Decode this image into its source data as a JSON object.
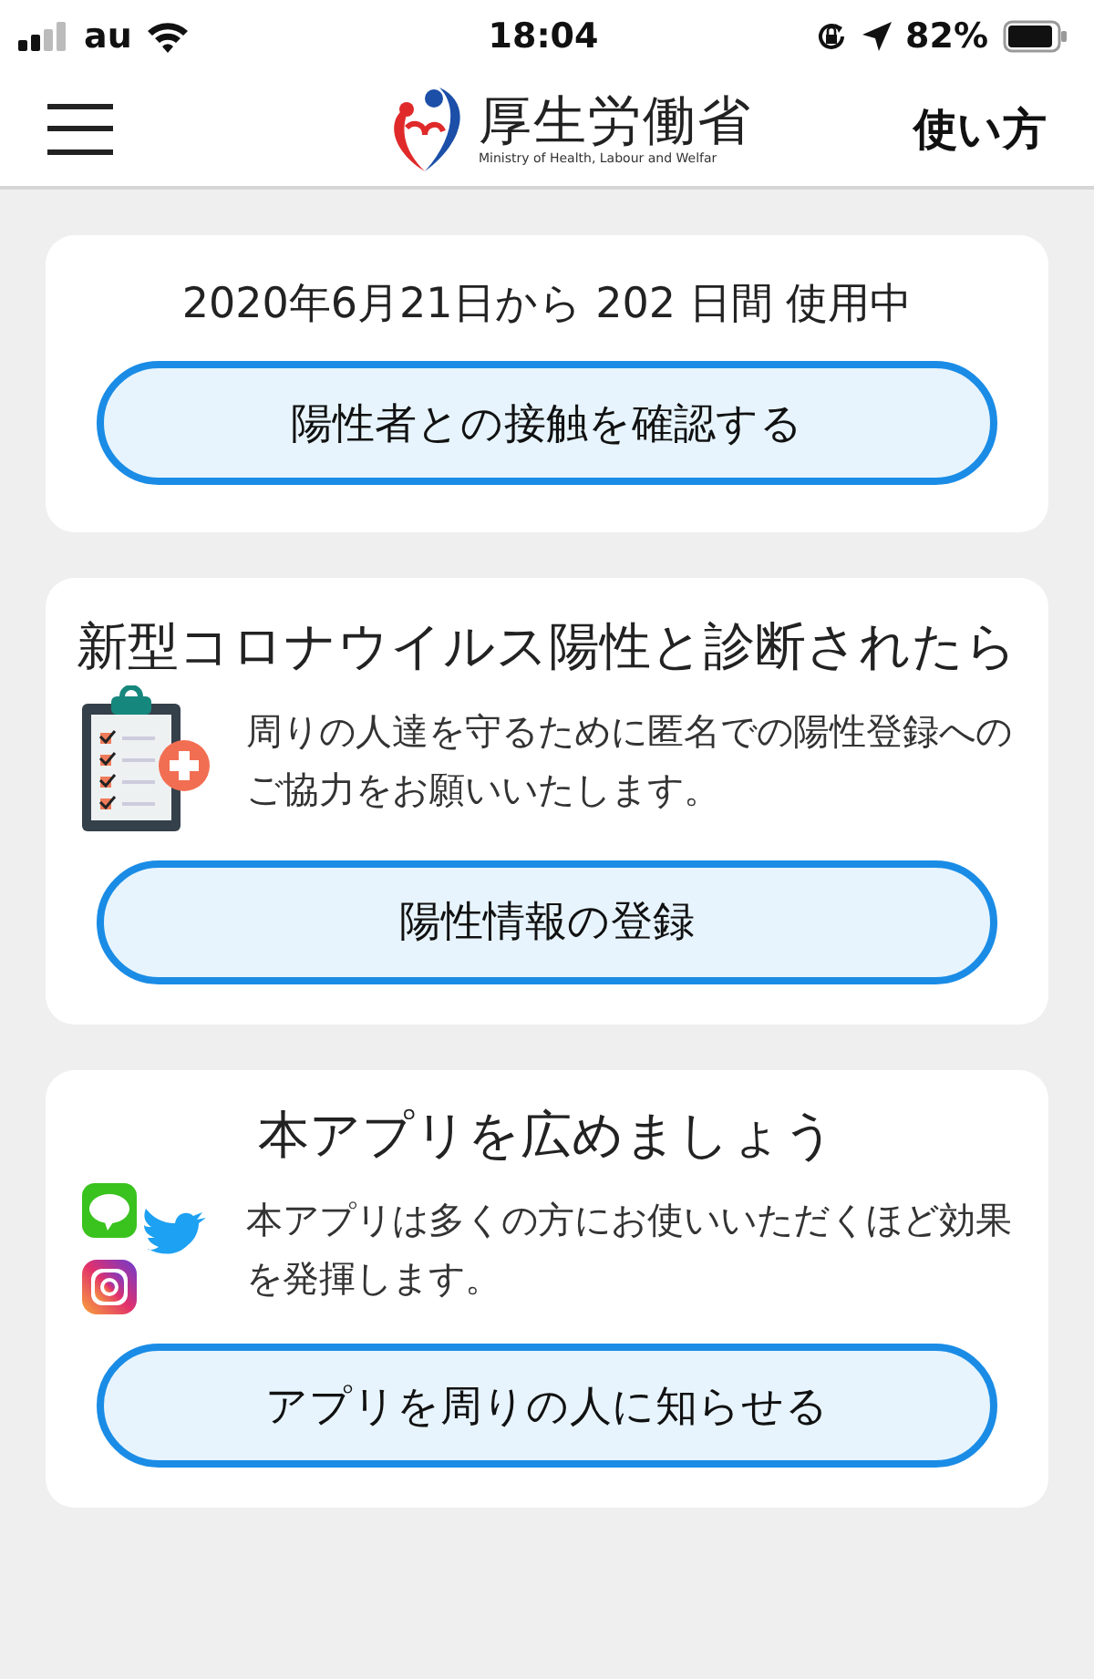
{
  "status_bar": {
    "carrier": "au",
    "time": "18:04",
    "battery": "82%"
  },
  "header": {
    "logo_title": "厚生労働省",
    "logo_subtitle": "Ministry of Health, Labour and Welfar",
    "help": "使い方"
  },
  "cards": [
    {
      "kind": "usage",
      "text": "2020年6月21日から 202 日間 使用中",
      "button": "陽性者との接触を確認する"
    },
    {
      "kind": "report",
      "title": "新型コロナウイルス陽性と診断されたら",
      "text": "周りの人達を守るために匿名での陽性登録へのご協力をお願いいたします。",
      "button": "陽性情報の登録"
    },
    {
      "kind": "share",
      "title": "本アプリを広めましょう",
      "text": "本アプリは多くの方にお使いいただくほど効果を発揮します。",
      "button": "アプリを周りの人に知らせる"
    }
  ]
}
